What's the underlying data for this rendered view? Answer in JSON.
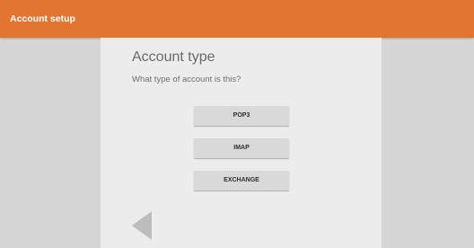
{
  "app_bar": {
    "title": "Account setup",
    "color": "#e2752f"
  },
  "main": {
    "heading": "Account type",
    "question": "What type of account is this?",
    "options": [
      {
        "label": "POP3"
      },
      {
        "label": "IMAP"
      },
      {
        "label": "EXCHANGE"
      }
    ],
    "back_icon": "back-arrow-icon"
  }
}
